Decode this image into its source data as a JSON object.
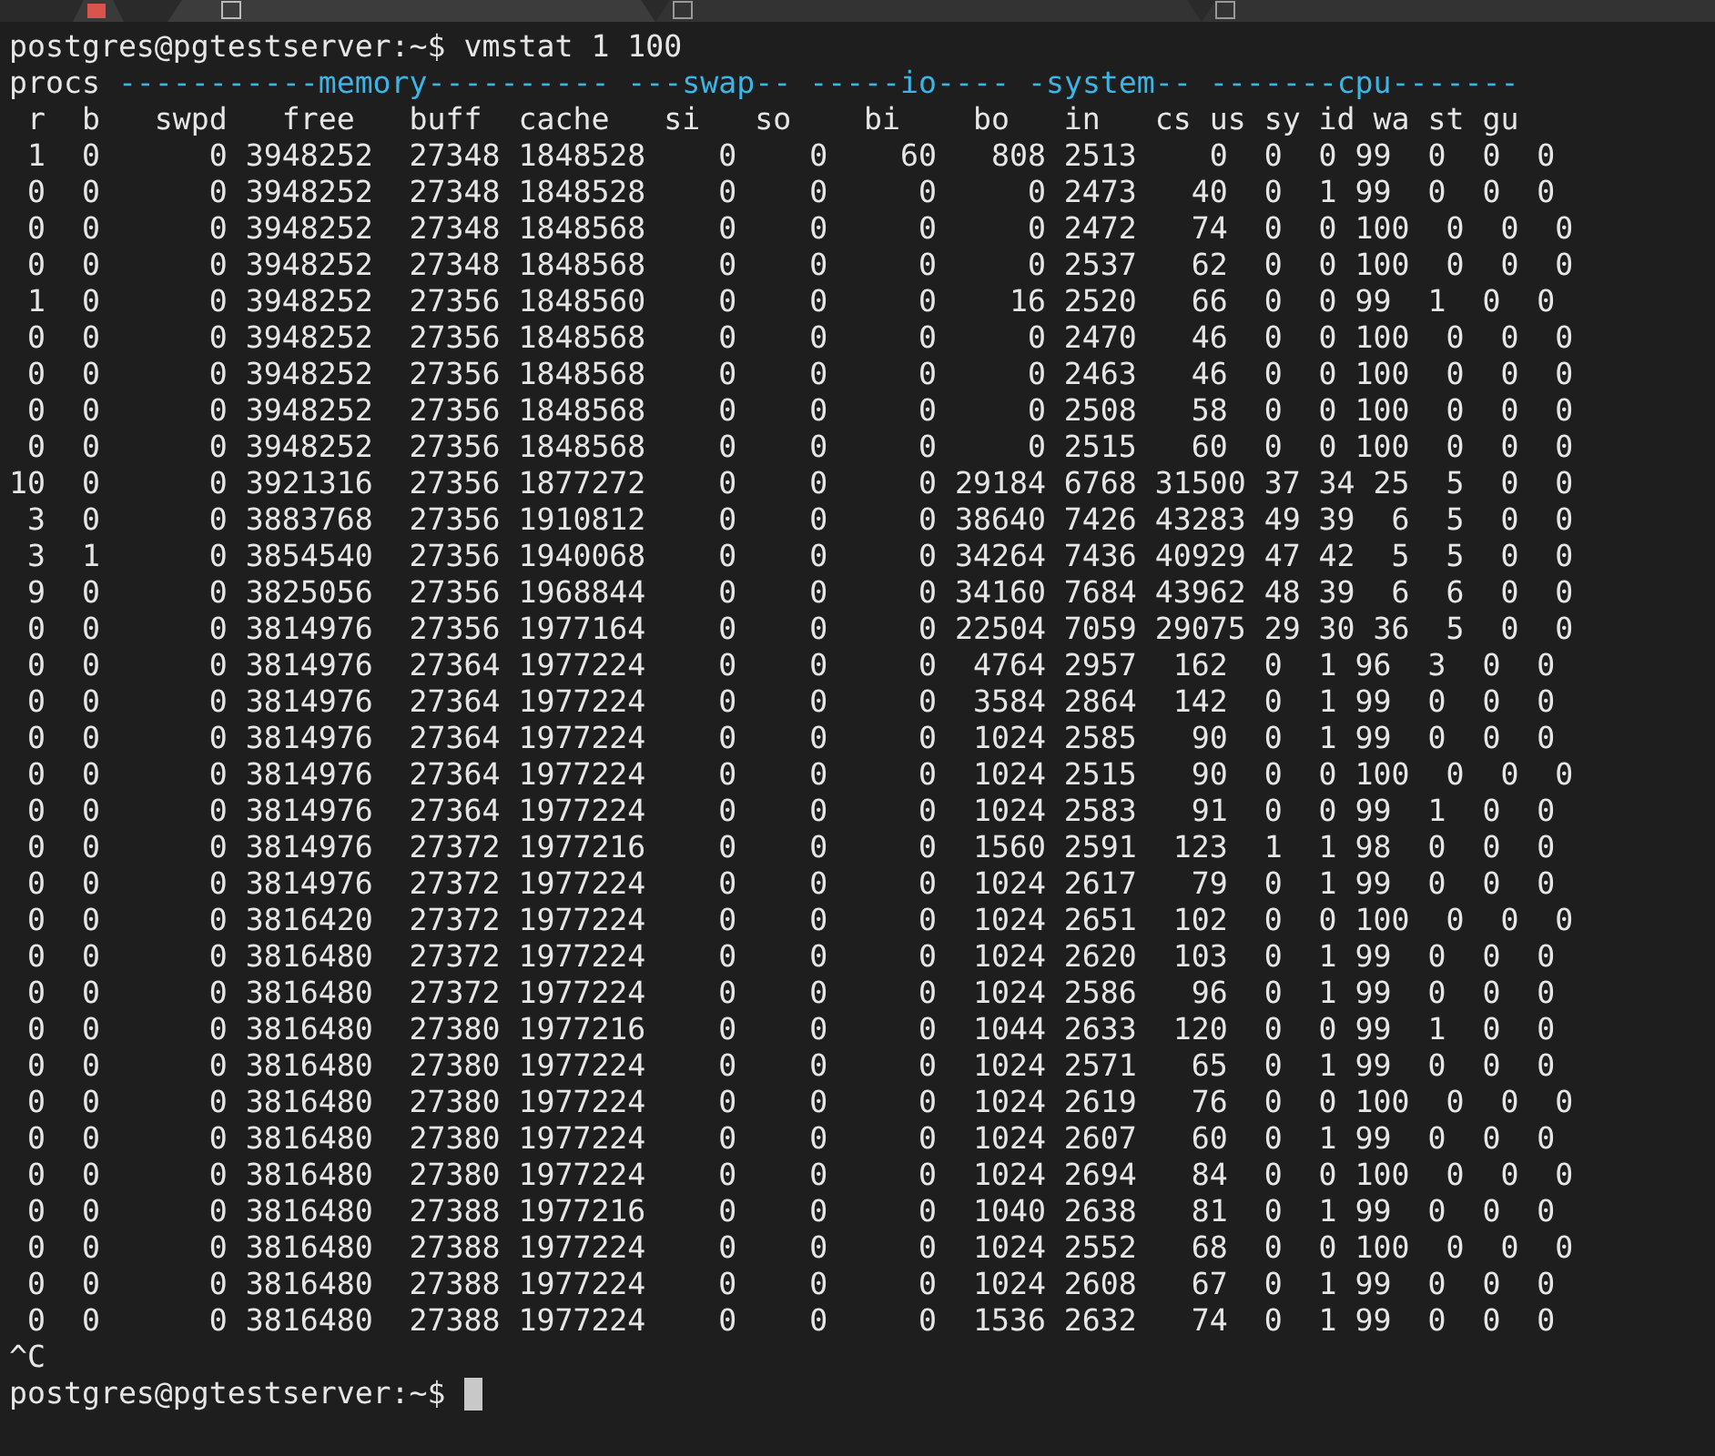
{
  "terminal": {
    "command_line": "postgres@pgtestserver:~$ vmstat 1 100",
    "group_header": [
      {
        "text": "procs",
        "kind": "label"
      },
      {
        "text": " -----------memory----------",
        "kind": "group"
      },
      {
        "text": " ---swap--",
        "kind": "group"
      },
      {
        "text": " -----io----",
        "kind": "group"
      },
      {
        "text": " -system--",
        "kind": "group"
      },
      {
        "text": " -------cpu-------",
        "kind": "group"
      }
    ],
    "column_header": " r  b   swpd   free   buff  cache   si   so    bi    bo   in   cs us sy id wa st gu",
    "rows": [
      " 1  0      0 3948252  27348 1848528    0    0    60   808 2513    0  0  0 99  0  0  0",
      " 0  0      0 3948252  27348 1848528    0    0     0     0 2473   40  0  1 99  0  0  0",
      " 0  0      0 3948252  27348 1848568    0    0     0     0 2472   74  0  0 100  0  0  0",
      " 0  0      0 3948252  27348 1848568    0    0     0     0 2537   62  0  0 100  0  0  0",
      " 1  0      0 3948252  27356 1848560    0    0     0    16 2520   66  0  0 99  1  0  0",
      " 0  0      0 3948252  27356 1848568    0    0     0     0 2470   46  0  0 100  0  0  0",
      " 0  0      0 3948252  27356 1848568    0    0     0     0 2463   46  0  0 100  0  0  0",
      " 0  0      0 3948252  27356 1848568    0    0     0     0 2508   58  0  0 100  0  0  0",
      " 0  0      0 3948252  27356 1848568    0    0     0     0 2515   60  0  0 100  0  0  0",
      "10  0      0 3921316  27356 1877272    0    0     0 29184 6768 31500 37 34 25  5  0  0",
      " 3  0      0 3883768  27356 1910812    0    0     0 38640 7426 43283 49 39  6  5  0  0",
      " 3  1      0 3854540  27356 1940068    0    0     0 34264 7436 40929 47 42  5  5  0  0",
      " 9  0      0 3825056  27356 1968844    0    0     0 34160 7684 43962 48 39  6  6  0  0",
      " 0  0      0 3814976  27356 1977164    0    0     0 22504 7059 29075 29 30 36  5  0  0",
      " 0  0      0 3814976  27364 1977224    0    0     0  4764 2957  162  0  1 96  3  0  0",
      " 0  0      0 3814976  27364 1977224    0    0     0  3584 2864  142  0  1 99  0  0  0",
      " 0  0      0 3814976  27364 1977224    0    0     0  1024 2585   90  0  1 99  0  0  0",
      " 0  0      0 3814976  27364 1977224    0    0     0  1024 2515   90  0  0 100  0  0  0",
      " 0  0      0 3814976  27364 1977224    0    0     0  1024 2583   91  0  0 99  1  0  0",
      " 0  0      0 3814976  27372 1977216    0    0     0  1560 2591  123  1  1 98  0  0  0",
      " 0  0      0 3814976  27372 1977224    0    0     0  1024 2617   79  0  1 99  0  0  0",
      " 0  0      0 3816420  27372 1977224    0    0     0  1024 2651  102  0  0 100  0  0  0",
      " 0  0      0 3816480  27372 1977224    0    0     0  1024 2620  103  0  1 99  0  0  0",
      " 0  0      0 3816480  27372 1977224    0    0     0  1024 2586   96  0  1 99  0  0  0",
      " 0  0      0 3816480  27380 1977216    0    0     0  1044 2633  120  0  0 99  1  0  0",
      " 0  0      0 3816480  27380 1977224    0    0     0  1024 2571   65  0  1 99  0  0  0",
      " 0  0      0 3816480  27380 1977224    0    0     0  1024 2619   76  0  0 100  0  0  0",
      " 0  0      0 3816480  27380 1977224    0    0     0  1024 2607   60  0  1 99  0  0  0",
      " 0  0      0 3816480  27380 1977224    0    0     0  1024 2694   84  0  0 100  0  0  0",
      " 0  0      0 3816480  27388 1977216    0    0     0  1040 2638   81  0  1 99  0  0  0",
      " 0  0      0 3816480  27388 1977224    0    0     0  1024 2552   68  0  0 100  0  0  0",
      " 0  0      0 3816480  27388 1977224    0    0     0  1024 2608   67  0  1 99  0  0  0",
      " 0  0      0 3816480  27388 1977224    0    0     0  1536 2632   74  0  1 99  0  0  0"
    ],
    "interrupt": "^C",
    "prompt": "postgres@pgtestserver:~$"
  }
}
